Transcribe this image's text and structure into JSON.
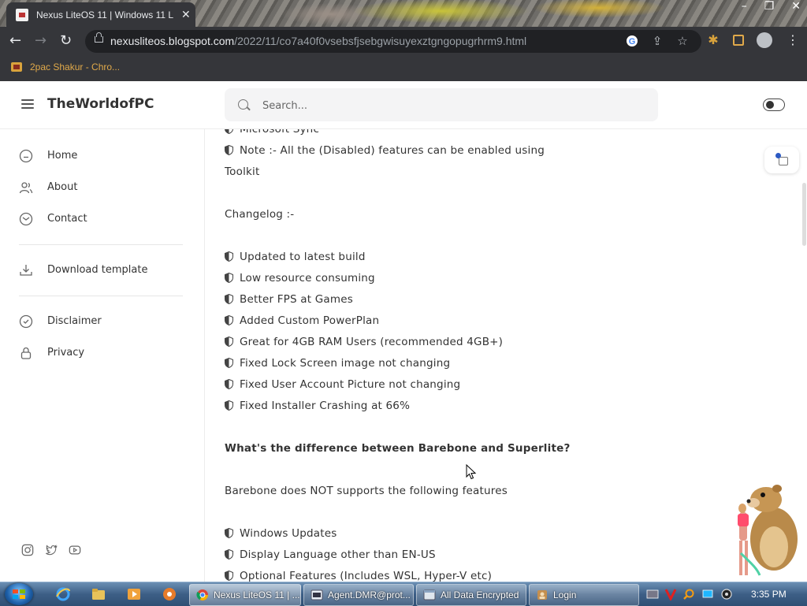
{
  "browser": {
    "tab_title": "Nexus LiteOS 11 | Windows 11 L",
    "url_host": "nexusliteos.blogspot.com",
    "url_path": "/2022/11/co7a40f0vsebsfjsebgwisuyexztgngopugrhrm9.html",
    "bookmark": "2pac Shakur - Chro..."
  },
  "header": {
    "site_title": "TheWorldofPC",
    "search_placeholder": "Search..."
  },
  "sidebar": {
    "items": [
      {
        "label": "Home",
        "icon": "home-icon"
      },
      {
        "label": "About",
        "icon": "users-icon"
      },
      {
        "label": "Contact",
        "icon": "mail-icon"
      },
      {
        "label": "Download template",
        "icon": "download-icon"
      },
      {
        "label": "Disclaimer",
        "icon": "shield-check-icon"
      },
      {
        "label": "Privacy",
        "icon": "lock-icon"
      }
    ],
    "socials": [
      "instagram-icon",
      "twitter-icon",
      "youtube-icon"
    ]
  },
  "content": {
    "lines": [
      {
        "text": "Microsoft Sync",
        "bullet": true
      },
      {
        "text": "Note :- All the (Disabled) features can be enabled using",
        "bullet": true
      },
      {
        "text": "Toolkit",
        "bullet": false
      },
      {
        "text": "Changelog :-",
        "bullet": false
      },
      {
        "text": "Updated to latest build",
        "bullet": true
      },
      {
        "text": "Low resource consuming",
        "bullet": true
      },
      {
        "text": "Better FPS at Games",
        "bullet": true
      },
      {
        "text": "Added Custom PowerPlan",
        "bullet": true
      },
      {
        "text": "Great for 4GB RAM Users (recommended 4GB+)",
        "bullet": true
      },
      {
        "text": "Fixed Lock Screen image not changing",
        "bullet": true
      },
      {
        "text": "Fixed User Account Picture not changing",
        "bullet": true
      },
      {
        "text": "Fixed Installer Crashing at 66%",
        "bullet": true
      },
      {
        "text": "What's the difference between Barebone and Superlite?",
        "bullet": false,
        "bold": true
      },
      {
        "text": "Barebone does NOT supports the following features",
        "bullet": false
      },
      {
        "text": "Windows Updates",
        "bullet": true
      },
      {
        "text": "Display Language other than EN-US",
        "bullet": true
      },
      {
        "text": "Optional Features (Includes WSL, Hyper-V etc)",
        "bullet": true
      }
    ]
  },
  "taskbar": {
    "buttons": [
      {
        "label": "Nexus LiteOS 11 | ...",
        "icon": "chrome-icon",
        "active": true
      },
      {
        "label": "Agent.DMR@prot...",
        "icon": "terminal-icon",
        "active": false
      },
      {
        "label": "All Data Encrypted",
        "icon": "window-icon",
        "active": false
      },
      {
        "label": "Login",
        "icon": "login-icon",
        "active": false
      }
    ],
    "clock": "3:35 PM"
  },
  "colors": {
    "chrome_dark": "#35363a",
    "omnibox_bg": "#202124",
    "text_main": "#333333",
    "bookmark_text": "#e0a94a",
    "accent_blue": "#2b59c3"
  }
}
